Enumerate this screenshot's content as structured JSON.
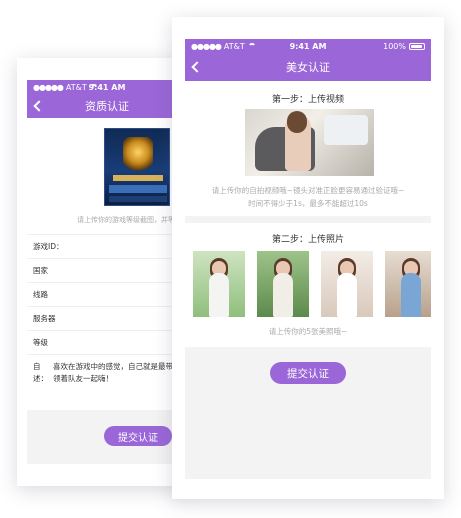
{
  "back_screen": {
    "status_bar": {
      "carrier": "AT&T",
      "time": "9:41 AM"
    },
    "nav": {
      "title": "资质认证"
    },
    "upload_hint": "请上传你的游戏等级截图，并等",
    "form": {
      "fields": [
        {
          "label": "游戏ID："
        },
        {
          "label": "国家"
        },
        {
          "label": "线路"
        },
        {
          "label": "服务器"
        },
        {
          "label": "等级"
        }
      ],
      "bio_label": "自述：",
      "bio_text": "喜欢在游戏中的感觉，自己就是最带领着队友一起嗨！"
    },
    "submit_label": "提交认证"
  },
  "front_screen": {
    "status_bar": {
      "carrier": "AT&T",
      "time": "9:41 AM",
      "battery": "100%"
    },
    "nav": {
      "title": "美女认证"
    },
    "step1": {
      "title": "第一步：上传视频",
      "hint_line1": "请上传你的自拍视频哦~镜头对准正脸更容易通过验证哦~",
      "hint_line2": "时间不得少于1s，最多不能超过10s"
    },
    "step2": {
      "title": "第二步：上传照片",
      "hint": "请上传你的5张美照哦~"
    },
    "submit_label": "提交认证"
  },
  "colors": {
    "accent": "#9b67d8"
  }
}
